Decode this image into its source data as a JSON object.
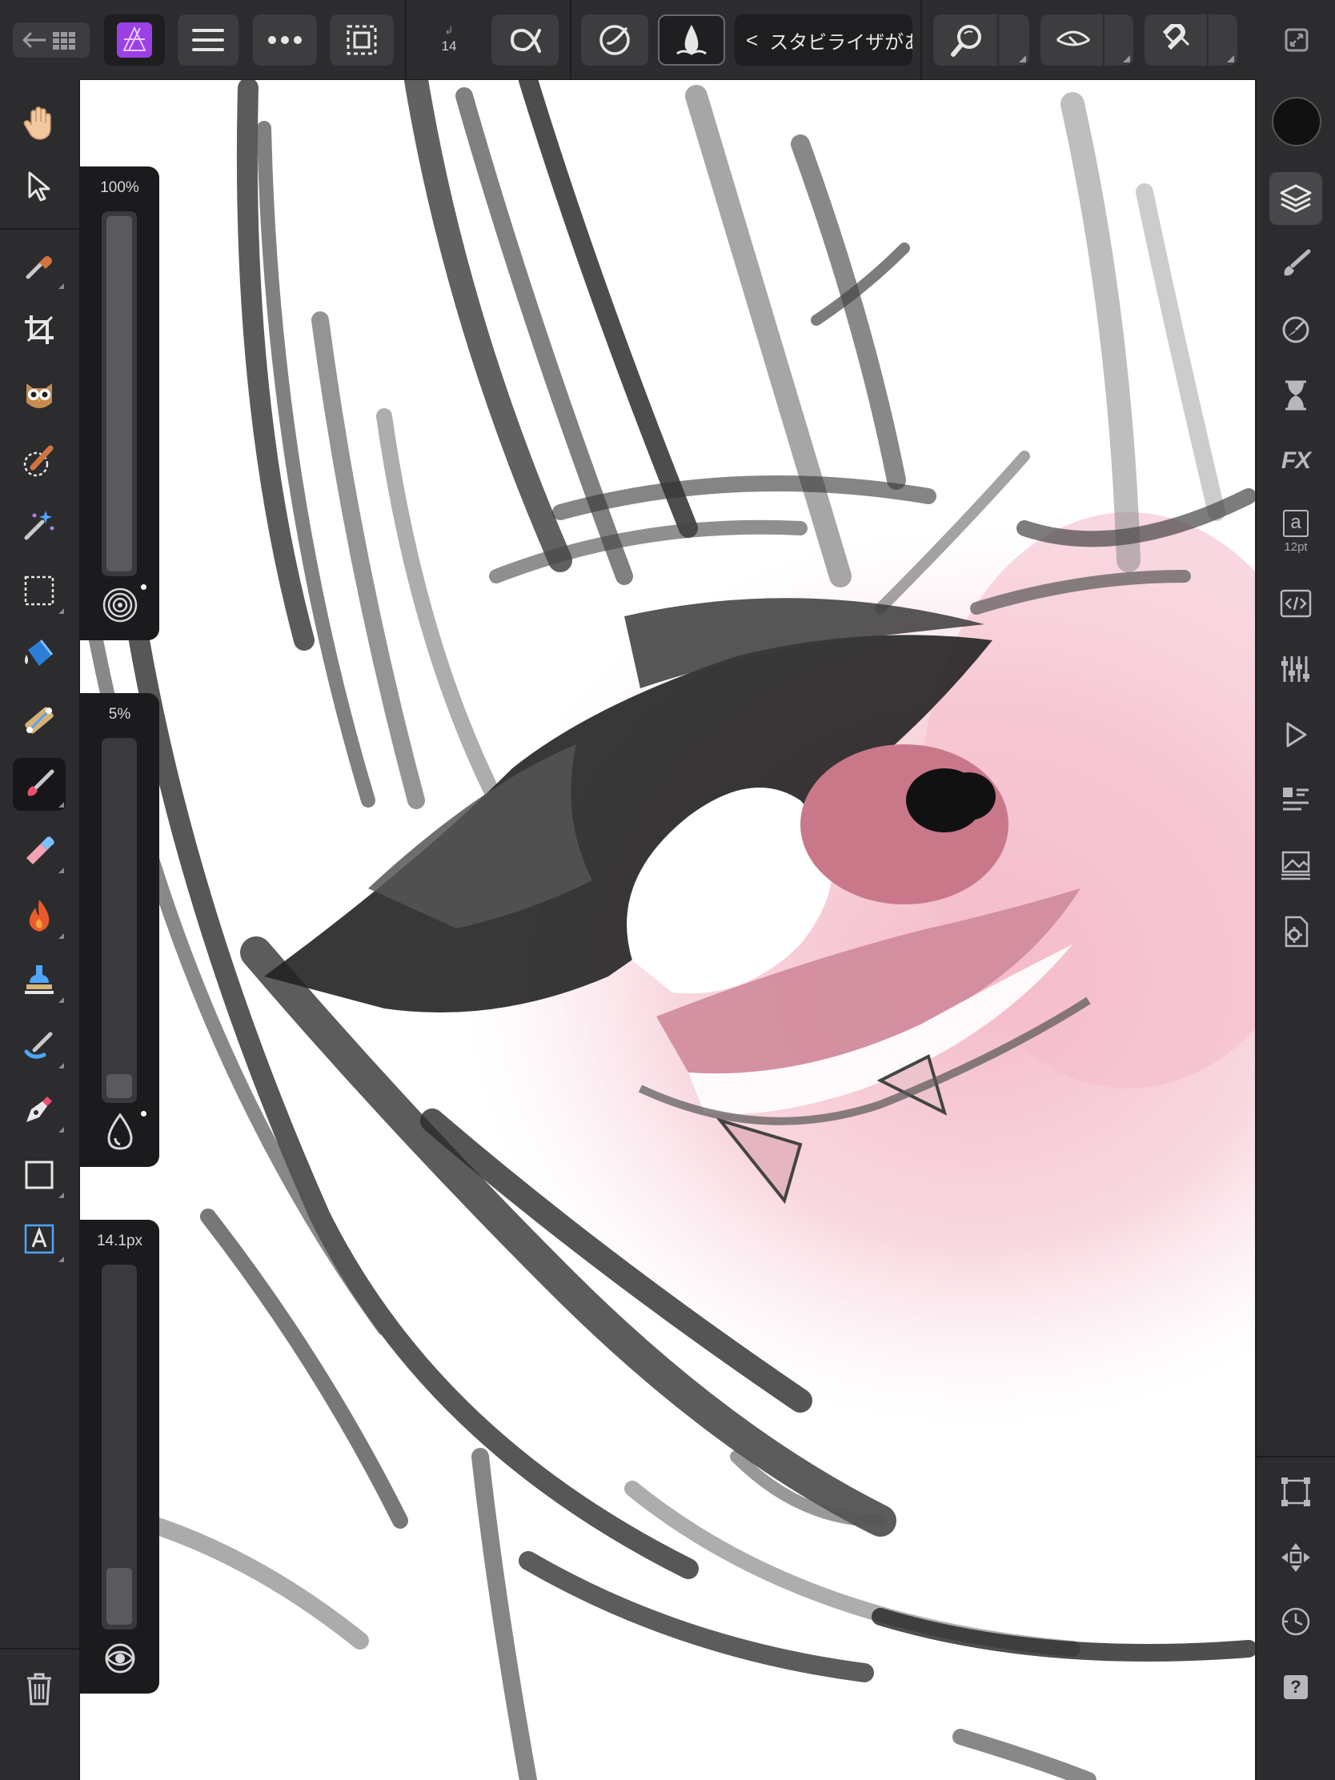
{
  "toolbar": {
    "back_label": "←",
    "brush_size_label": "14",
    "stabilizer_text": "スタビライザがあ",
    "stabilizer_chevron": "<"
  },
  "left_tools": [
    {
      "name": "view-tool",
      "icon": "hand-icon"
    },
    {
      "name": "move-tool",
      "icon": "pointer-icon"
    },
    {
      "name": "color-picker-tool",
      "icon": "eyedropper-icon"
    },
    {
      "name": "crop-tool",
      "icon": "crop-icon"
    },
    {
      "name": "red-eye-tool",
      "icon": "owl-icon"
    },
    {
      "name": "selection-brush-tool",
      "icon": "selection-brush-icon"
    },
    {
      "name": "flood-select-tool",
      "icon": "magic-wand-icon"
    },
    {
      "name": "marquee-tool",
      "icon": "marquee-icon"
    },
    {
      "name": "flood-fill-tool",
      "icon": "paint-bucket-icon"
    },
    {
      "name": "gradient-tool",
      "icon": "gradient-icon"
    },
    {
      "name": "paint-brush-tool",
      "icon": "paint-brush-icon"
    },
    {
      "name": "erase-brush-tool",
      "icon": "eraser-icon"
    },
    {
      "name": "dodge-burn-tool",
      "icon": "flame-icon"
    },
    {
      "name": "clone-brush-tool",
      "icon": "stamp-icon"
    },
    {
      "name": "smudge-tool",
      "icon": "smudge-icon"
    },
    {
      "name": "pen-tool",
      "icon": "pen-nib-icon"
    },
    {
      "name": "rectangle-tool",
      "icon": "rectangle-icon"
    },
    {
      "name": "artistic-text-tool",
      "icon": "text-icon"
    },
    {
      "name": "delete-button",
      "icon": "trash-icon"
    }
  ],
  "sliders": {
    "opacity": {
      "label": "100%",
      "value": 1.0,
      "icon": "concentric-circles-icon"
    },
    "flow": {
      "label": "5%",
      "value": 0.05,
      "icon": "droplet-icon"
    },
    "width": {
      "label": "14.1px",
      "value": 0.16,
      "icon": "eye-target-icon"
    }
  },
  "right_panels": {
    "text_size_label": "12pt",
    "text_glyph": "a",
    "fx_label": "FX",
    "help_glyph": "?"
  },
  "colors": {
    "accent": "#9b3fe6",
    "active_tool": "#171719",
    "primary_color": "#111111"
  }
}
